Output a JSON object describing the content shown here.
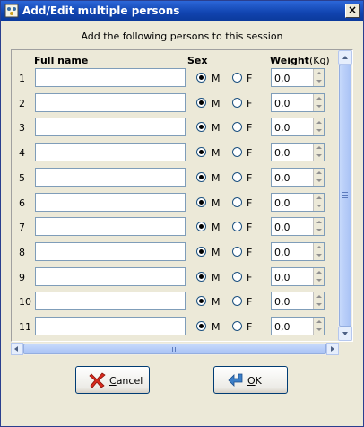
{
  "window": {
    "title": "Add/Edit multiple persons",
    "close_glyph": "×"
  },
  "subtitle": "Add the following persons to this session",
  "columns": {
    "full_name": "Full name",
    "sex": "Sex",
    "weight": "Weight",
    "weight_unit": "(Kg)"
  },
  "rows": [
    {
      "num": "1",
      "name": "",
      "sex": "M",
      "male_label": "M",
      "female_label": "F",
      "weight": "0,0"
    },
    {
      "num": "2",
      "name": "",
      "sex": "M",
      "male_label": "M",
      "female_label": "F",
      "weight": "0,0"
    },
    {
      "num": "3",
      "name": "",
      "sex": "M",
      "male_label": "M",
      "female_label": "F",
      "weight": "0,0"
    },
    {
      "num": "4",
      "name": "",
      "sex": "M",
      "male_label": "M",
      "female_label": "F",
      "weight": "0,0"
    },
    {
      "num": "5",
      "name": "",
      "sex": "M",
      "male_label": "M",
      "female_label": "F",
      "weight": "0,0"
    },
    {
      "num": "6",
      "name": "",
      "sex": "M",
      "male_label": "M",
      "female_label": "F",
      "weight": "0,0"
    },
    {
      "num": "7",
      "name": "",
      "sex": "M",
      "male_label": "M",
      "female_label": "F",
      "weight": "0,0"
    },
    {
      "num": "8",
      "name": "",
      "sex": "M",
      "male_label": "M",
      "female_label": "F",
      "weight": "0,0"
    },
    {
      "num": "9",
      "name": "",
      "sex": "M",
      "male_label": "M",
      "female_label": "F",
      "weight": "0,0"
    },
    {
      "num": "10",
      "name": "",
      "sex": "M",
      "male_label": "M",
      "female_label": "F",
      "weight": "0,0"
    },
    {
      "num": "11",
      "name": "",
      "sex": "M",
      "male_label": "M",
      "female_label": "F",
      "weight": "0,0"
    }
  ],
  "buttons": {
    "cancel": {
      "mnemonic": "C",
      "rest": "ancel",
      "icon": "red-x-icon"
    },
    "ok": {
      "mnemonic": "O",
      "rest": "K",
      "icon": "enter-arrow-icon"
    }
  },
  "colors": {
    "titlebar": "#1144b0",
    "window_bg": "#ece9d8",
    "input_border": "#7f9db9",
    "cancel_icon": "#d92b1f",
    "ok_icon": "#3c7fc8"
  }
}
